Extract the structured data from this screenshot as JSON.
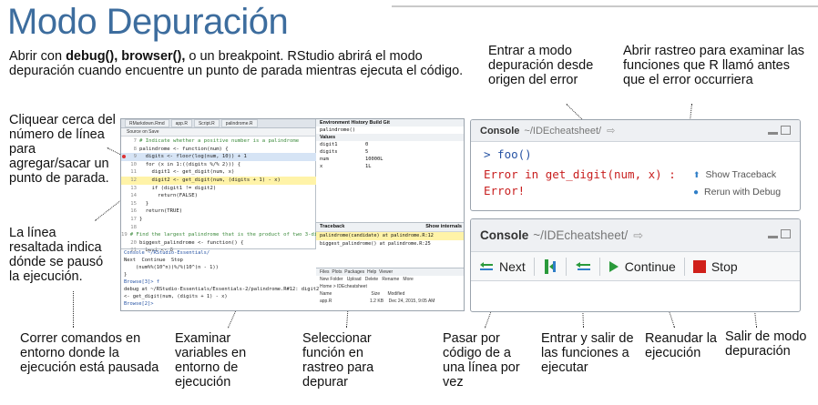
{
  "title": "Modo Depuración",
  "intro": {
    "part1": "Abrir con ",
    "bold": "debug(), browser(),",
    "part2": " o un breakpoint. RStudio abrirá el modo depuración cuando encuentre un punto de parada mientras ejecuta el código."
  },
  "notes": {
    "click_line": "Cliquear cerca del número de línea para agregar/sacar un punto de parada.",
    "highlighted_line": "La línea resaltada indica dónde se pausó la ejecución.",
    "run_commands": "Correr comandos en entorno donde la ejecución está pausada",
    "examine_vars": "Examinar variables en entorno de ejecución",
    "select_function": "Seleccionar función en rastreo para depurar",
    "enter_debug": "Entrar a modo depuración desde origen del error",
    "open_traceback": "Abrir rastreo para examinar las funciones que R llamó antes que el error occurriera",
    "step_next": "Pasar por código de a una línea por vez",
    "step_in_out": "Entrar y salir de las funciones a ejecutar",
    "resume": "Reanudar la ejecución",
    "exit_debug": "Salir de modo depuración"
  },
  "ide": {
    "tabs": [
      "RMarkdown.Rmd",
      "app.R",
      "Script.R",
      "palindrome.R"
    ],
    "editor_toolbar": "Source on Save",
    "code_lines": [
      {
        "n": "7",
        "text": "# Indicate whether a positive number is a palindrome",
        "cls": "cmt"
      },
      {
        "n": "8",
        "text": "palindrome <- function(num) {",
        "cls": ""
      },
      {
        "n": "9",
        "text": "  digits <- floor(log(num, 10)) + 1",
        "cls": "",
        "bp": true,
        "sel": true
      },
      {
        "n": "10",
        "text": "  for (x in 1:((digits %/% 2))) {",
        "cls": ""
      },
      {
        "n": "11",
        "text": "    digit1 <- get_digit(num, x)",
        "cls": ""
      },
      {
        "n": "12",
        "text": "    digit2 <- get_digit(num, (digits + 1) - x)",
        "cls": "",
        "hl": true
      },
      {
        "n": "13",
        "text": "    if (digit1 != digit2)",
        "cls": ""
      },
      {
        "n": "14",
        "text": "      return(FALSE)",
        "cls": ""
      },
      {
        "n": "15",
        "text": "  }",
        "cls": ""
      },
      {
        "n": "16",
        "text": "  return(TRUE)",
        "cls": ""
      },
      {
        "n": "17",
        "text": "}",
        "cls": ""
      },
      {
        "n": "18",
        "text": "",
        "cls": ""
      },
      {
        "n": "19",
        "text": "# Find the largest palindrome that is the product of two 3-digit",
        "cls": "cmt"
      },
      {
        "n": "20",
        "text": "biggest_palindrome <- function() {",
        "cls": ""
      },
      {
        "n": "21",
        "text": "  best <- 0",
        "cls": ""
      }
    ],
    "console_lines": [
      {
        "text": "Console ~/RStudio-Essentials/",
        "cls": "blue"
      },
      {
        "text": "Next  Continue  Stop",
        "cls": ""
      },
      {
        "text": "    (num%%(10^n))%/%(10^(n - 1))",
        "cls": ""
      },
      {
        "text": "}",
        "cls": ""
      },
      {
        "text": "Browse[3]> f",
        "cls": "blue"
      },
      {
        "text": "debug at ~/RStudio-Essentials/Essentials-2/palindrome.R#12: digit2",
        "cls": ""
      },
      {
        "text": "<- get_digit(num, (digits + 1) - x)",
        "cls": ""
      },
      {
        "text": "Browse[2]>",
        "cls": "blue"
      }
    ],
    "env_tabs": "Environment  History  Build  Git",
    "env_scope": "palindrome()",
    "env_section": "Values",
    "env_values": [
      {
        "name": "digit1",
        "value": "0"
      },
      {
        "name": "digits",
        "value": "5"
      },
      {
        "name": "num",
        "value": "10000L"
      },
      {
        "name": "x",
        "value": "1L"
      }
    ],
    "traceback_title": "Traceback",
    "traceback_show": "Show internals",
    "traceback_rows": [
      "palindrome(candidate) at palindrome.R:12",
      "biggest_palindrome() at palindrome.R:25"
    ],
    "files_rows": [
      "Files  Plots  Packages  Help  Viewer",
      "New Folder   Upload   Delete   Rename   More",
      "Home > IDEcheatsheet",
      "Name                               Size      Modified",
      "app.R                              1.2 KB    Dec 24, 2015, 9:05 AM"
    ]
  },
  "console1": {
    "label": "Console",
    "path": "~/IDEcheatsheet/",
    "prompt": "> foo()",
    "error1": "Error in get_digit(num, x) :",
    "error2": "Error!",
    "show_traceback": "Show Traceback",
    "rerun_debug": "Rerun with Debug"
  },
  "console2": {
    "label": "Console",
    "path": "~/IDEcheatsheet/",
    "next": "Next",
    "continue": "Continue",
    "stop": "Stop"
  },
  "colors": {
    "title": "#3d6d9e",
    "error": "#c81e1e",
    "accent_blue": "#2552a3",
    "green": "#2a9a3b",
    "stop_red": "#d0201a"
  }
}
